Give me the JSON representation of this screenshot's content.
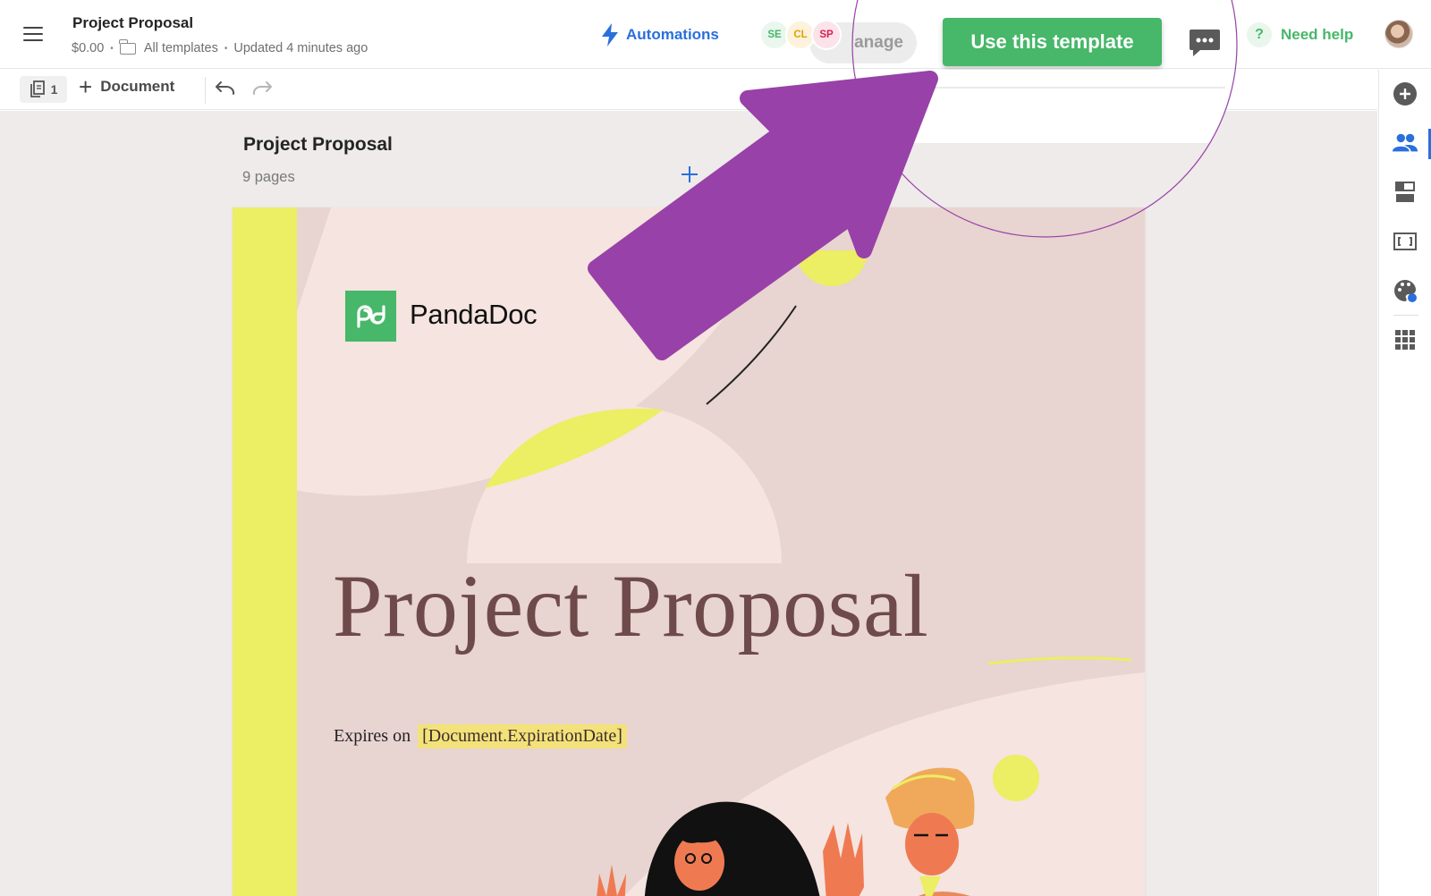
{
  "header": {
    "title": "Project Proposal",
    "price": "$0.00",
    "folder": "All templates",
    "updated": "Updated 4 minutes ago",
    "automations_label": "Automations",
    "avatars": [
      {
        "initials": "SE",
        "color": "#47b769",
        "bg": "#eaf6ee"
      },
      {
        "initials": "CL",
        "color": "#e2a200",
        "bg": "#fdf3dc"
      },
      {
        "initials": "SP",
        "color": "#d6204f",
        "bg": "#fce3ea"
      }
    ],
    "manage_label": "anage",
    "use_template_label": "Use this template",
    "need_help_label": "Need help",
    "help_glyph": "?"
  },
  "toolbar": {
    "pages_count": "1",
    "add_document_label": "Document",
    "add_glyph": "+"
  },
  "canvas": {
    "doc_title": "Project Proposal",
    "page_count_label": "9 pages"
  },
  "page": {
    "logo_text": "PandaDoc",
    "heading": "Project Proposal",
    "expires_label": "Expires on",
    "expiration_variable": "[Document.ExpirationDate]"
  },
  "rail": {
    "icons": [
      "add-circle-icon",
      "recipients-icon",
      "content-blocks-icon",
      "fields-icon",
      "design-palette-icon",
      "apps-grid-icon"
    ],
    "active": "recipients-icon"
  },
  "colors": {
    "accent_green": "#47b769",
    "link_blue": "#2a6fdb",
    "annotation_purple": "#9841a8",
    "page_yellow": "#ecee63",
    "page_pink": "#e8d4d0",
    "heading_brown": "#6e4a4a"
  }
}
